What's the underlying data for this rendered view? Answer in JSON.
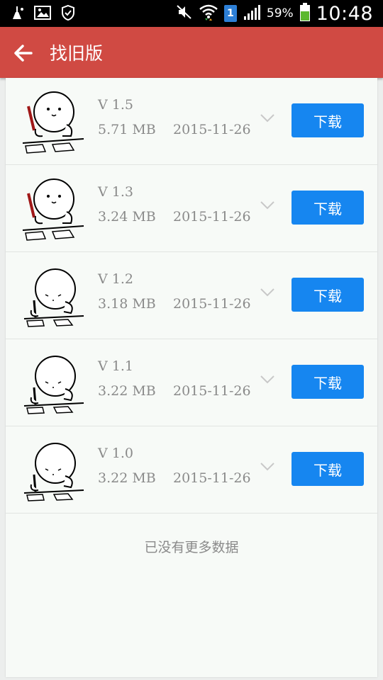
{
  "status_bar": {
    "battery_percent": "59%",
    "time": "10:48",
    "notification_badge": "1",
    "icons": [
      "cleaner-icon",
      "gallery-icon",
      "security-icon",
      "mute-icon",
      "wifi-icon",
      "signal-icon",
      "battery-icon"
    ]
  },
  "header": {
    "title": "找旧版",
    "back_icon": "arrow-left-icon"
  },
  "versions": [
    {
      "version": "V 1.5",
      "size": "5.71 MB",
      "date": "2015-11-26",
      "button": "下载",
      "thumb_variant": "color"
    },
    {
      "version": "V 1.3",
      "size": "3.24 MB",
      "date": "2015-11-26",
      "button": "下载",
      "thumb_variant": "color"
    },
    {
      "version": "V 1.2",
      "size": "3.18 MB",
      "date": "2015-11-26",
      "button": "下载",
      "thumb_variant": "mono"
    },
    {
      "version": "V 1.1",
      "size": "3.22 MB",
      "date": "2015-11-26",
      "button": "下载",
      "thumb_variant": "mono"
    },
    {
      "version": "V 1.0",
      "size": "3.22 MB",
      "date": "2015-11-26",
      "button": "下载",
      "thumb_variant": "mono"
    }
  ],
  "footer_text": "已没有更多数据",
  "colors": {
    "app_bar": "#d04a43",
    "download_button": "#1686f0",
    "meta_text": "#8a8a8a"
  }
}
